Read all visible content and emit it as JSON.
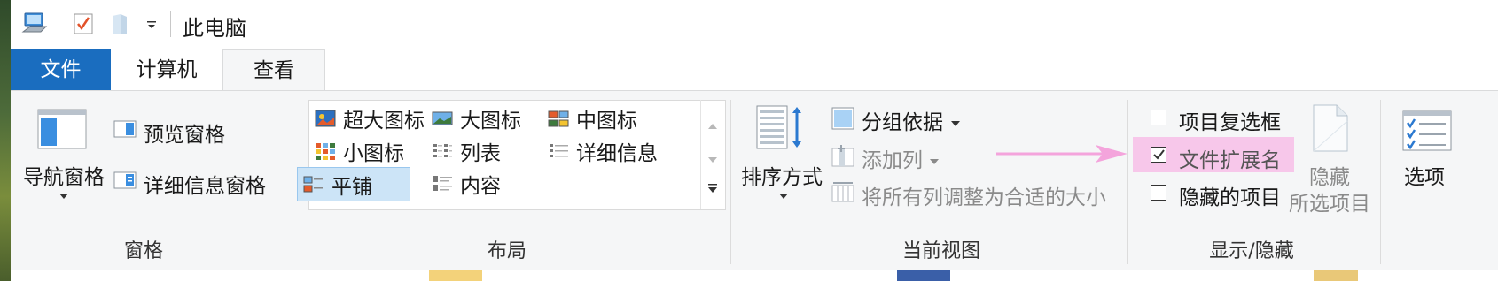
{
  "title": "此电脑",
  "tabs": {
    "file": "文件",
    "computer": "计算机",
    "view": "查看"
  },
  "panes": {
    "nav_pane": "导航窗格",
    "preview_pane": "预览窗格",
    "details_pane": "详细信息窗格",
    "group_label": "窗格"
  },
  "layout": {
    "items": [
      "超大图标",
      "大图标",
      "中图标",
      "小图标",
      "列表",
      "详细信息",
      "平铺",
      "内容"
    ],
    "selected": "平铺",
    "group_label": "布局"
  },
  "current_view": {
    "sort_by": "排序方式",
    "group_by": "分组依据",
    "add_columns": "添加列",
    "size_all_columns": "将所有列调整为合适的大小",
    "group_label": "当前视图"
  },
  "show_hide": {
    "item_checkboxes": "项目复选框",
    "item_checkboxes_checked": false,
    "file_extensions": "文件扩展名",
    "file_extensions_checked": true,
    "hidden_items": "隐藏的项目",
    "hidden_items_checked": false,
    "hide_selected_line1": "隐藏",
    "hide_selected_line2": "所选项目",
    "group_label": "显示/隐藏"
  },
  "options": "选项",
  "colors": {
    "file_tab": "#1a6dbf",
    "highlight": "#f7c7ea",
    "arrow": "#f4a4dc",
    "accent": "#2b79d0"
  }
}
